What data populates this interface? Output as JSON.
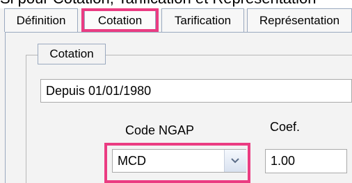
{
  "top_text": "Si pour Cotation, Tarification et Représentation",
  "tabs": [
    {
      "label": "Définition"
    },
    {
      "label": "Cotation"
    },
    {
      "label": "Tarification"
    },
    {
      "label": "Représentation"
    }
  ],
  "groupbox": {
    "title": "Cotation"
  },
  "date_field": {
    "value": "Depuis 01/01/1980"
  },
  "code_ngap": {
    "label": "Code NGAP",
    "value": "MCD"
  },
  "coef": {
    "label": "Coef.",
    "value": "1.00"
  },
  "colors": {
    "highlight": "#ea3c82",
    "border": "#9aa9bf",
    "panel": "#f3f3f3"
  },
  "icons": {
    "combo": "chevron-down-icon"
  }
}
